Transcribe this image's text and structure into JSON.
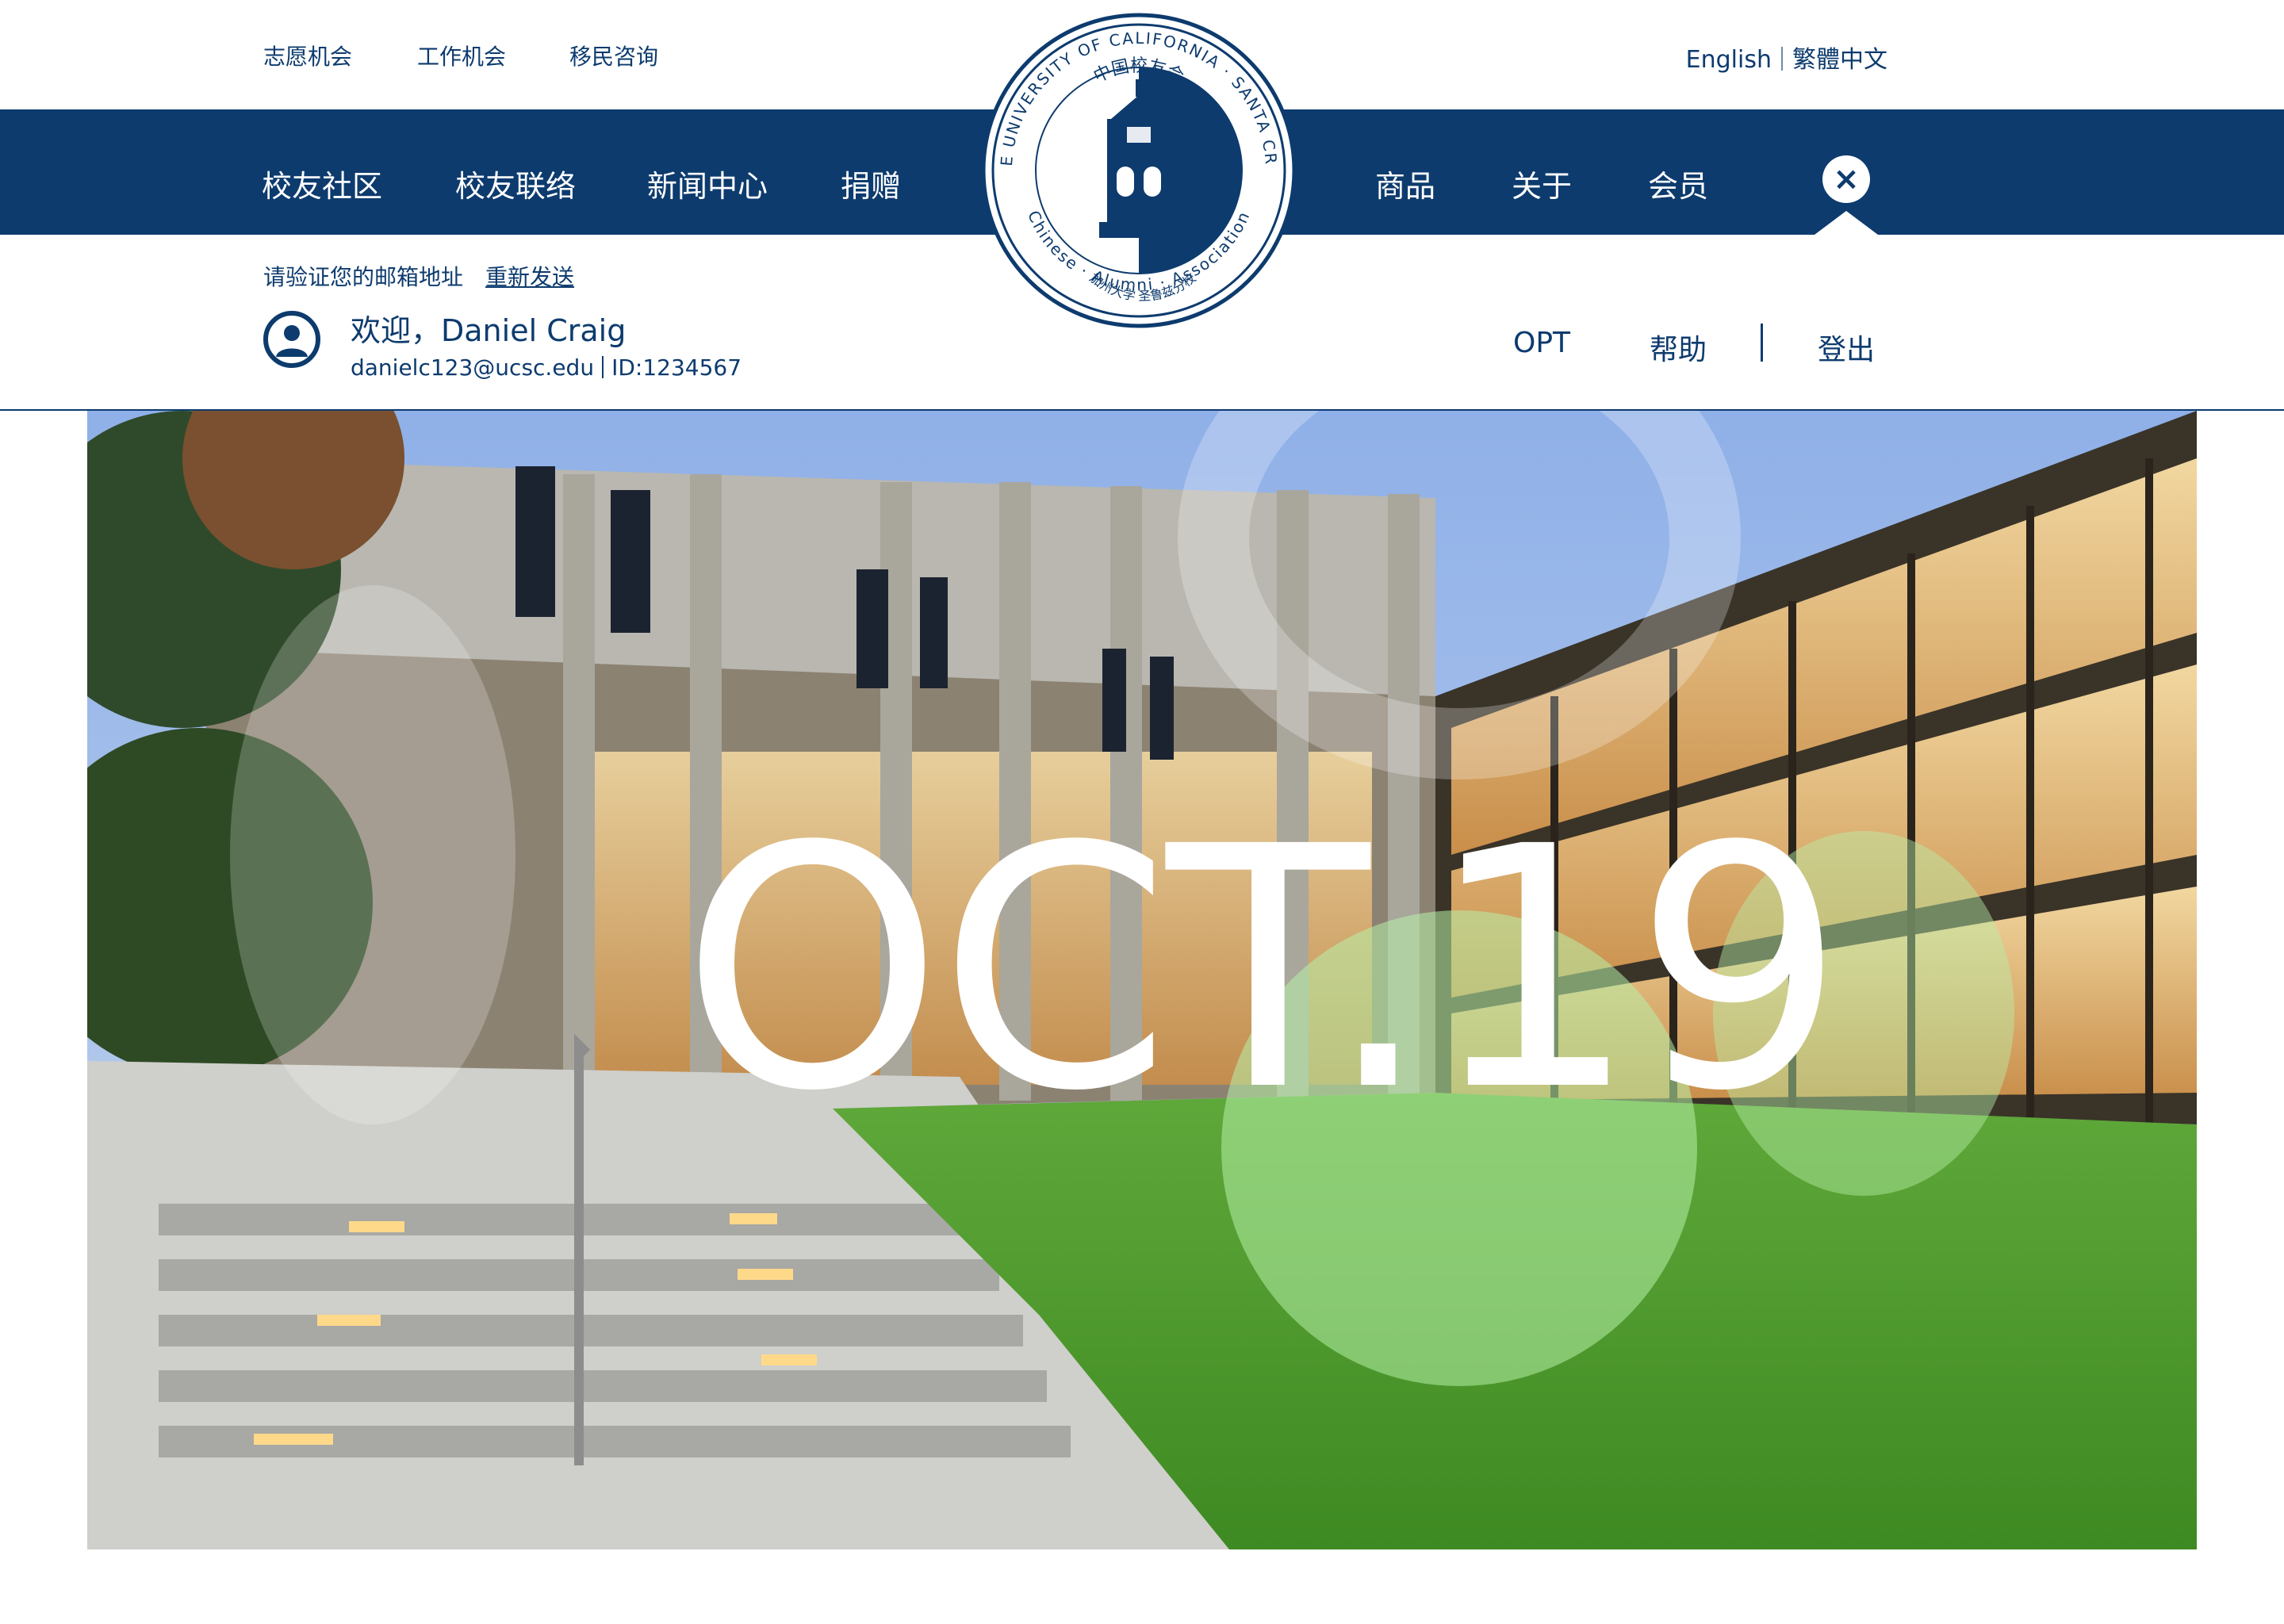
{
  "top_links": [
    "志愿机会",
    "工作机会",
    "移民咨询"
  ],
  "language": {
    "english": "English",
    "traditional_chinese": "繁體中文"
  },
  "nav_left": [
    "校友社区",
    "校友联络",
    "新闻中心",
    "捐赠"
  ],
  "nav_right": [
    "商品",
    "关于",
    "会员"
  ],
  "close_icon": "close-icon",
  "logo": {
    "outer_text": "THE UNIVERSITY OF CALIFORNIA · SANTA CRUZ",
    "inner_top": "中国校友会",
    "inner_bottom": "加州大学 圣鲁兹分校",
    "outer_bottom": "Chinese · Alumni · Association"
  },
  "user": {
    "verify_text": "请验证您的邮箱地址",
    "resend": "重新发送",
    "welcome": "欢迎，Daniel Craig",
    "email": "danielc123@ucsc.edu",
    "id": "ID:1234567"
  },
  "sub_nav": {
    "opt": "OPT",
    "help": "帮助",
    "logout": "登出"
  },
  "hero": {
    "date_text": "OCT.19"
  },
  "colors": {
    "brand_navy": "#0d3b6e",
    "accent_green": "#b7f0a8"
  }
}
